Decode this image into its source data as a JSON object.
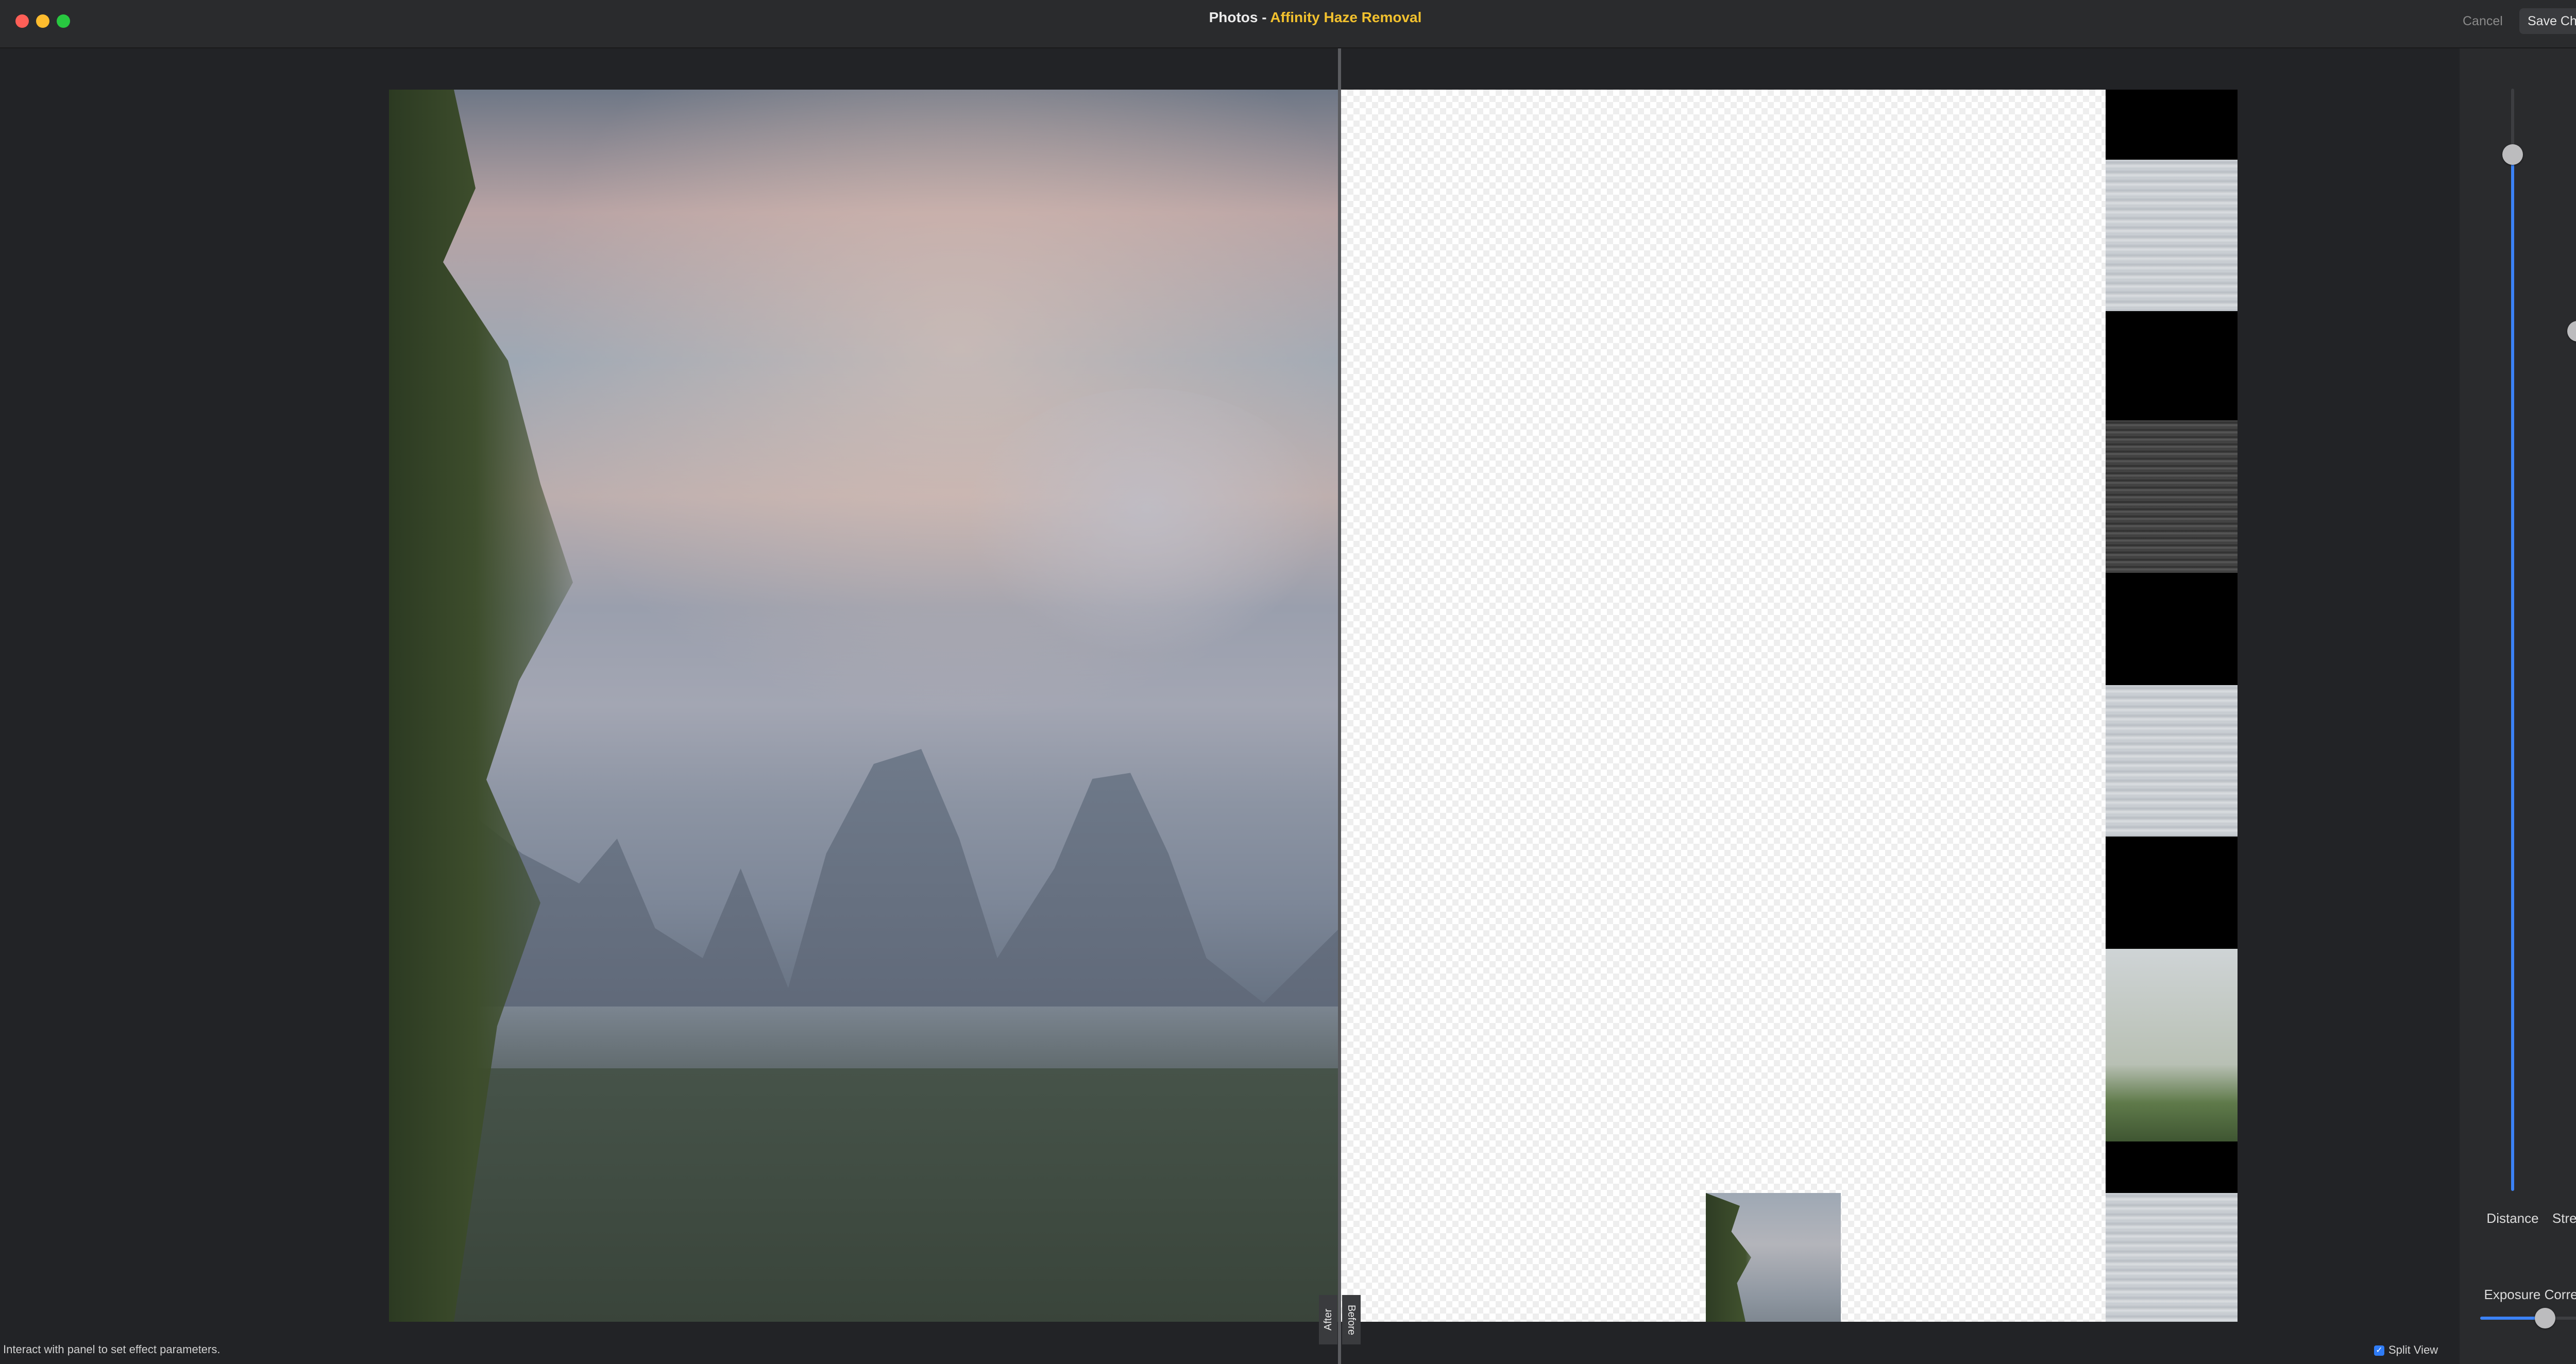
{
  "window": {
    "app_name": "Photos",
    "separator": " - ",
    "extension_name": "Affinity Haze Removal",
    "title_accent_color": "#f2c12e"
  },
  "toolbar": {
    "cancel_label": "Cancel",
    "save_label": "Save Changes"
  },
  "canvas": {
    "after_label": "After",
    "before_label": "Before"
  },
  "status": {
    "message": "Interact with panel to set effect parameters."
  },
  "panel": {
    "sliders": [
      {
        "label": "Distance",
        "value_fraction": 0.94
      },
      {
        "label": "Strength",
        "value_fraction": 0.78
      }
    ],
    "exposure": {
      "label": "Exposure Correction",
      "value_fraction": 0.5
    },
    "split_view": {
      "label": "Split View",
      "checked": true
    },
    "accent_color": "#3b82f6"
  }
}
